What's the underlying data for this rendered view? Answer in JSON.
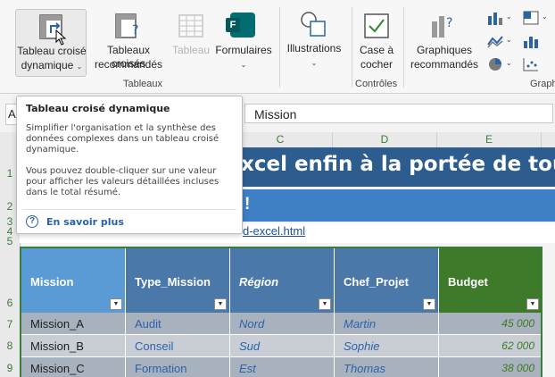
{
  "ribbon": {
    "pivot_table": {
      "line1": "Tableau croisé",
      "line2": "dynamique"
    },
    "recommended_pivots": {
      "line1": "Tableaux croisés",
      "line2": "recommandés"
    },
    "table": "Tableau",
    "forms": "Formulaires",
    "illustrations": "Illustrations",
    "checkbox": {
      "line1": "Case à",
      "line2": "cocher"
    },
    "recommended_charts": {
      "line1": "Graphiques",
      "line2": "recommandés"
    },
    "group_tables": "Tableaux",
    "group_controls": "Contrôles",
    "group_charts": "Graph",
    "forms_letter": "F"
  },
  "formula_bar": {
    "name_stub": "A",
    "value": "Mission"
  },
  "columns": [
    "C",
    "D",
    "E"
  ],
  "rows": [
    "1",
    "2",
    "3",
    "4",
    "5",
    "6",
    "7",
    "8",
    "9"
  ],
  "sheet": {
    "banner_title": "xcel enfin à la portée de tous",
    "banner_sub": "!",
    "link": "ttps://www.excel-plus.fr/tableau-croise-dynamique-excel/croisé-et-tcd-excel.html",
    "link_visible": "d-excel.html"
  },
  "table": {
    "headers": [
      "Mission",
      "Type_Mission",
      "Région",
      "Chef_Projet",
      "Budget"
    ],
    "header_colors": [
      "#5b9bd5",
      "#4a78a8",
      "#4a78a8",
      "#4a78a8",
      "#3d7a2a"
    ],
    "rows": [
      [
        "Mission_A",
        "Audit",
        "Nord",
        "Martin",
        "45 000"
      ],
      [
        "Mission_B",
        "Conseil",
        "Sud",
        "Sophie",
        "62 000"
      ],
      [
        "Mission_C",
        "Formation",
        "Est",
        "Thomas",
        "38 000"
      ]
    ],
    "row_colors": [
      "#a8b2bf",
      "#c9ced6",
      "#a8b2bf"
    ]
  },
  "tooltip": {
    "title": "Tableau croisé dynamique",
    "p1": "Simplifier l'organisation et la synthèse des données complexes dans un tableau croisé dynamique.",
    "p2": "Vous pouvez double-cliquer sur une valeur pour afficher les valeurs détaillées incluses dans le total résumé.",
    "help_icon": "?",
    "help_link": "En savoir plus"
  },
  "colors": {
    "banner_dark": "#2d5d8f",
    "banner_light": "#3d7ec4",
    "table_border": "#3a7d3a"
  }
}
